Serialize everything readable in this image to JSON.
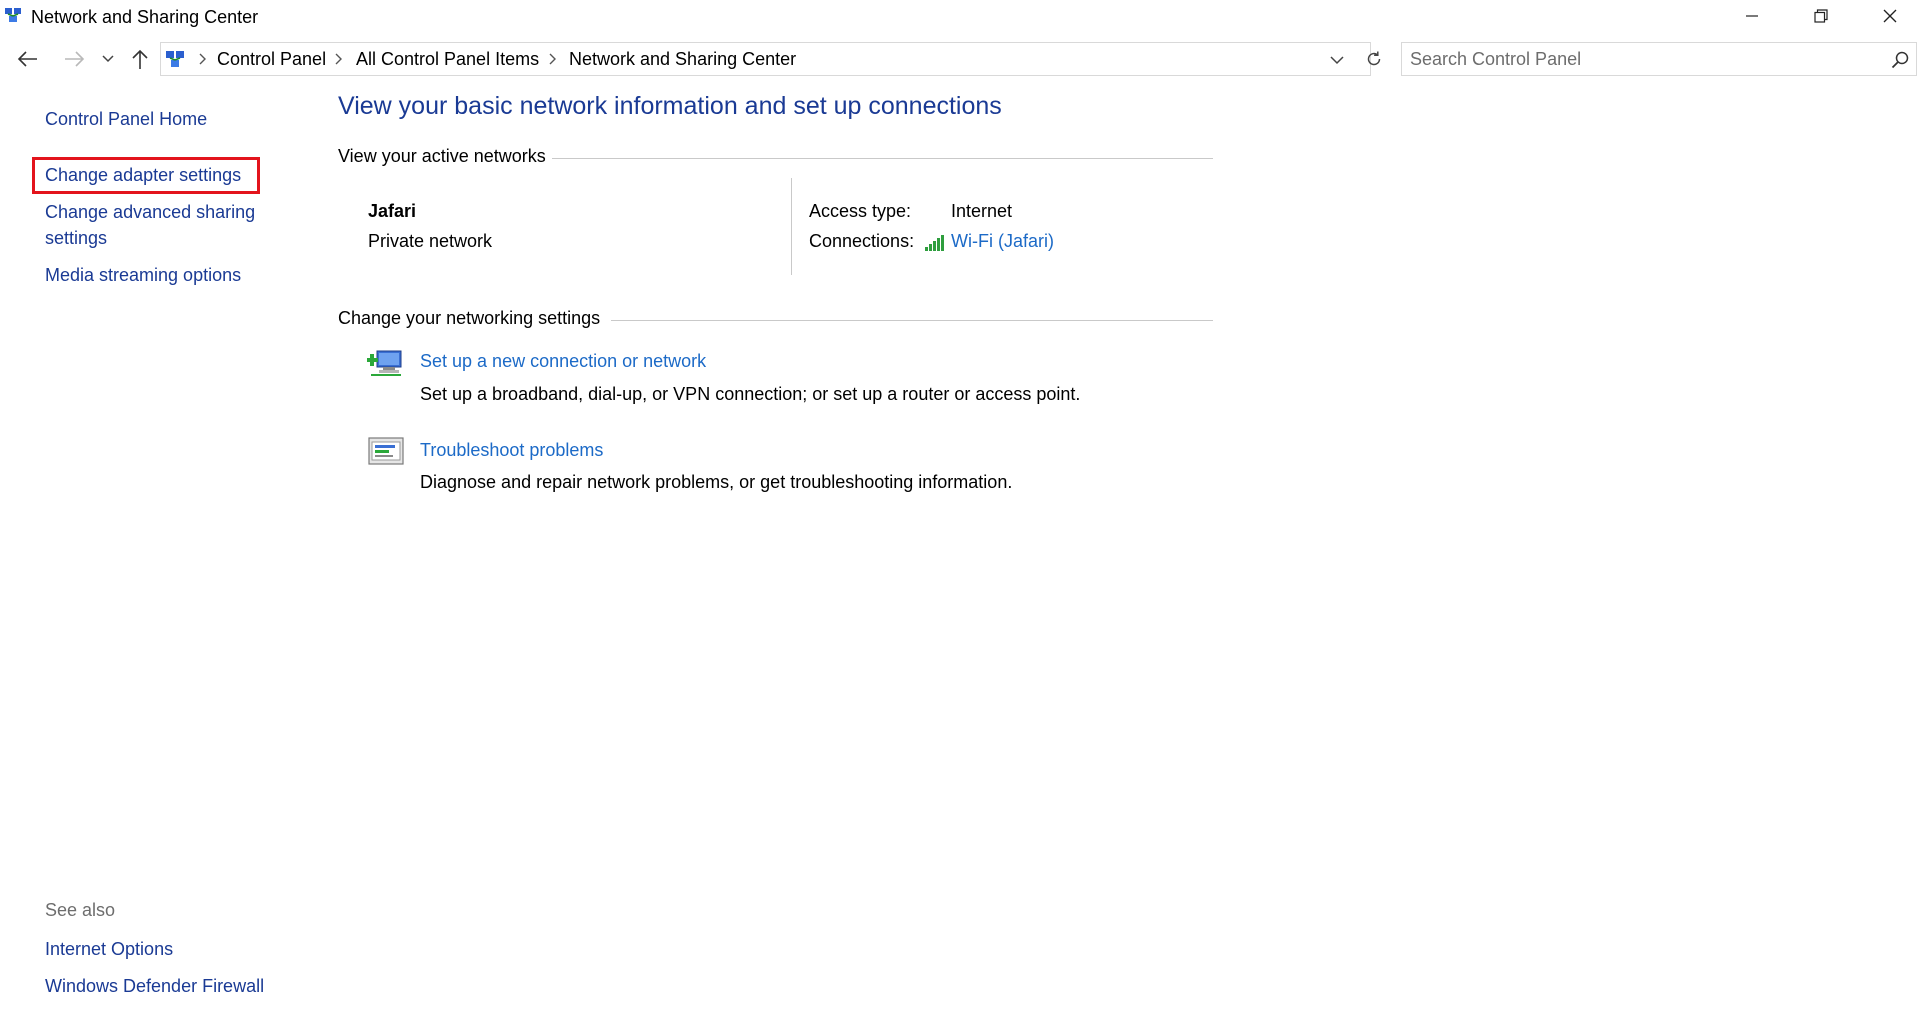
{
  "window": {
    "title": "Network and Sharing Center"
  },
  "address": {
    "crumbs": [
      "Control Panel",
      "All Control Panel Items",
      "Network and Sharing Center"
    ]
  },
  "search": {
    "placeholder": "Search Control Panel"
  },
  "sidebar": {
    "links": [
      "Control Panel Home",
      "Change adapter settings",
      "Change advanced sharing",
      "settings",
      "Media streaming options"
    ],
    "see_also_title": "See also",
    "see_also_links": [
      "Internet Options",
      "Windows Defender Firewall"
    ]
  },
  "main": {
    "title": "View your basic network information and set up connections",
    "active_networks_heading": "View your active networks",
    "network": {
      "name": "Jafari",
      "type": "Private network",
      "access_type_label": "Access type:",
      "access_type_value": "Internet",
      "connections_label": "Connections:",
      "connections_value": "Wi-Fi (Jafari)"
    },
    "change_settings_heading": "Change your networking settings",
    "tasks": [
      {
        "link": "Set up a new connection or network",
        "description": "Set up a broadband, dial-up, or VPN connection; or set up a router or access point."
      },
      {
        "link": "Troubleshoot problems",
        "description": "Diagnose and repair network problems, or get troubleshooting information."
      }
    ]
  },
  "colors": {
    "link_dark": "#1a3a94",
    "link_blue": "#1c6ac7",
    "highlight": "#e3141c",
    "wifi_green": "#2e9e3e"
  },
  "icons": {
    "title": "network-center-icon",
    "back": "arrow-left-icon",
    "forward": "arrow-right-icon",
    "recent": "chevron-down-icon",
    "up": "arrow-up-icon",
    "refresh": "refresh-icon",
    "search": "search-icon",
    "wifi": "wifi-signal-icon"
  }
}
